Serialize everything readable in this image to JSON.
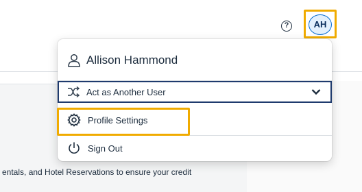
{
  "header": {
    "help_glyph": "?",
    "avatar_initials": "AH"
  },
  "menu": {
    "user_name": "Allison Hammond",
    "act_as_label": "Act as Another User",
    "profile_settings_label": "Profile Settings",
    "sign_out_label": "Sign Out"
  },
  "background": {
    "partial_text": "entals, and Hotel Reservations to ensure your credit"
  },
  "colors": {
    "highlight": "#f0ab00",
    "avatar_border": "#0a6ed1",
    "avatar_fill": "#e3f0fd",
    "text": "#1d2d3e",
    "act_as_border": "#1f3b6e"
  },
  "icons": {
    "help": "help-circle-icon",
    "user": "person-outline-icon",
    "act_as": "shuffle-icon",
    "dropdown": "chevron-down-icon",
    "profile": "gear-icon",
    "sign_out": "power-icon"
  }
}
